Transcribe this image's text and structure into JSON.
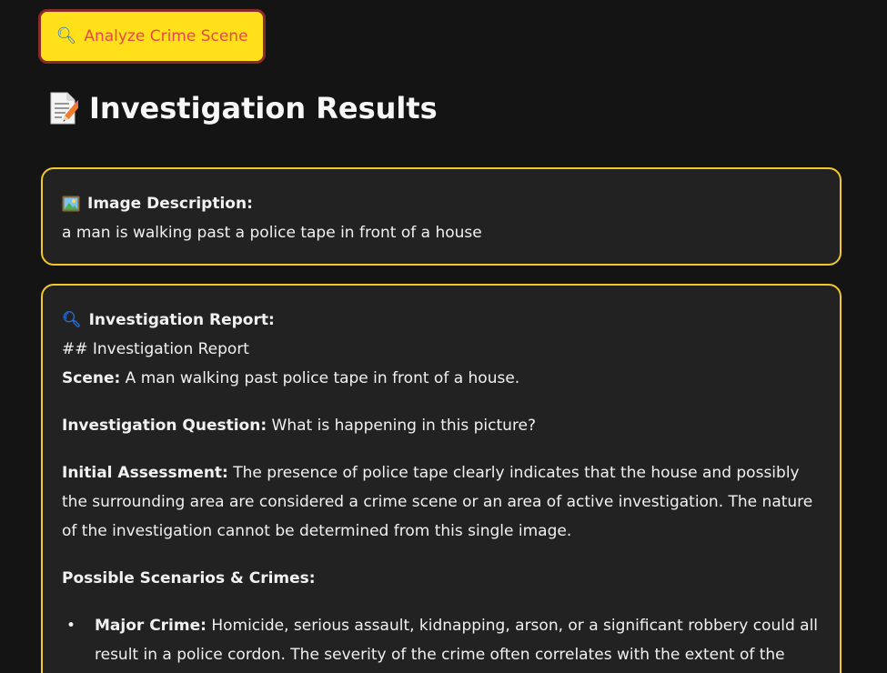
{
  "analyze_button": {
    "icon": "magnifying-glass-icon",
    "label": "Analyze Crime Scene"
  },
  "results": {
    "icon": "memo-icon",
    "heading": "Investigation Results"
  },
  "description_card": {
    "icon": "framed-picture-icon",
    "title": "Image Description:",
    "text": "a man is walking past a police tape in front of a house"
  },
  "report_card": {
    "icon": "magnifying-glass-icon",
    "title": "Investigation Report:",
    "markdown_heading": "## Investigation Report",
    "scene_label": "Scene:",
    "scene_text": " A man walking past police tape in front of a house.",
    "question_label": "Investigation Question:",
    "question_text": " What is happening in this picture?",
    "assessment_label": "Initial Assessment:",
    "assessment_text": " The presence of police tape clearly indicates that the house and possibly the surrounding area are considered a crime scene or an area of active investigation. The nature of the investigation cannot be determined from this single image.",
    "scenarios_label": "Possible Scenarios & Crimes:",
    "bullets": [
      {
        "label": "Major Crime:",
        "text": " Homicide, serious assault, kidnapping, arson, or a significant robbery could all result in a police cordon. The severity of the crime often correlates with the extent of the cordon."
      }
    ]
  },
  "colors": {
    "background": "#141414",
    "card_background": "#222222",
    "card_border": "#f2c928",
    "button_background": "#ffe01a",
    "button_text": "#e44a48",
    "button_border": "#8b2a2a"
  }
}
